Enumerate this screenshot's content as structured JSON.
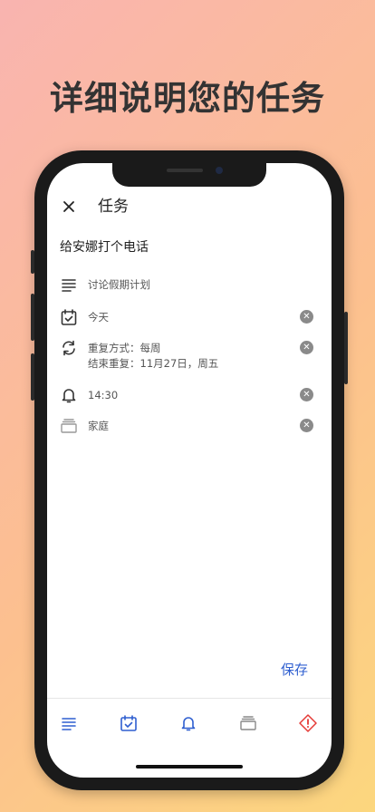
{
  "headline": "详细说明您的任务",
  "header": {
    "title": "任务"
  },
  "task": {
    "title": "给安娜打个电话"
  },
  "fields": {
    "notes": "讨论假期计划",
    "date": "今天",
    "repeat_line1": "重复方式：每周",
    "repeat_line2": "结束重复：11月27日，周五",
    "reminder": "14:30",
    "list": "家庭"
  },
  "actions": {
    "save": "保存"
  },
  "icons": {
    "close": "close-icon",
    "notes": "notes-icon",
    "date": "calendar-check-icon",
    "repeat": "repeat-icon",
    "reminder": "bell-icon",
    "list": "folder-icon",
    "priority": "priority-diamond-icon"
  },
  "colors": {
    "accent": "#2f5fd0",
    "priority": "#e53935"
  }
}
